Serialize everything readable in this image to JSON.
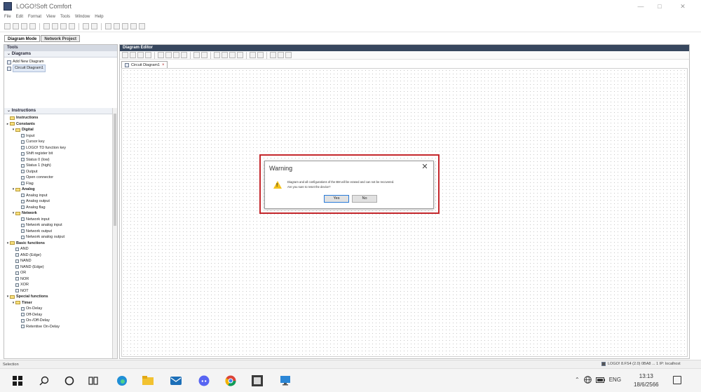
{
  "window": {
    "title": "LOGO!Soft Comfort",
    "controls": [
      "—",
      "□",
      "✕"
    ]
  },
  "menu": [
    "File",
    "Edit",
    "Format",
    "View",
    "Tools",
    "Window",
    "Help"
  ],
  "tabs": [
    "Diagram Mode",
    "Network Project"
  ],
  "left_panel": {
    "header": "Tools",
    "diagrams_title": "Diagrams",
    "diagrams": [
      "Add New Diagram",
      "Circuit Diagram1"
    ],
    "instructions_title": "Instructions",
    "tree": [
      {
        "level": 0,
        "label": "Instructions",
        "type": "folder",
        "expander": "",
        "bold": true
      },
      {
        "level": 0,
        "label": "Constants",
        "type": "folder",
        "expander": "▸",
        "bold": true
      },
      {
        "level": 1,
        "label": "Digital",
        "type": "folder",
        "expander": "▾",
        "bold": true
      },
      {
        "level": 2,
        "label": "Input",
        "type": "leaf"
      },
      {
        "level": 2,
        "label": "Cursor key",
        "type": "leaf"
      },
      {
        "level": 2,
        "label": "LOGO! TD function key",
        "type": "leaf"
      },
      {
        "level": 2,
        "label": "Shift register bit",
        "type": "leaf"
      },
      {
        "level": 2,
        "label": "Status 0 (low)",
        "type": "leaf"
      },
      {
        "level": 2,
        "label": "Status 1 (high)",
        "type": "leaf"
      },
      {
        "level": 2,
        "label": "Output",
        "type": "leaf"
      },
      {
        "level": 2,
        "label": "Open connector",
        "type": "leaf"
      },
      {
        "level": 2,
        "label": "Flag",
        "type": "leaf"
      },
      {
        "level": 1,
        "label": "Analog",
        "type": "folder",
        "expander": "▾",
        "bold": true
      },
      {
        "level": 2,
        "label": "Analog input",
        "type": "leaf"
      },
      {
        "level": 2,
        "label": "Analog output",
        "type": "leaf"
      },
      {
        "level": 2,
        "label": "Analog flag",
        "type": "leaf"
      },
      {
        "level": 1,
        "label": "Network",
        "type": "folder",
        "expander": "▾",
        "bold": true
      },
      {
        "level": 2,
        "label": "Network input",
        "type": "leaf"
      },
      {
        "level": 2,
        "label": "Network analog input",
        "type": "leaf"
      },
      {
        "level": 2,
        "label": "Network output",
        "type": "leaf"
      },
      {
        "level": 2,
        "label": "Network analog output",
        "type": "leaf"
      },
      {
        "level": 0,
        "label": "Basic functions",
        "type": "folder",
        "expander": "▾",
        "bold": true
      },
      {
        "level": 1,
        "label": "AND",
        "type": "leaf"
      },
      {
        "level": 1,
        "label": "AND (Edge)",
        "type": "leaf"
      },
      {
        "level": 1,
        "label": "NAND",
        "type": "leaf"
      },
      {
        "level": 1,
        "label": "NAND (Edge)",
        "type": "leaf"
      },
      {
        "level": 1,
        "label": "OR",
        "type": "leaf"
      },
      {
        "level": 1,
        "label": "NOR",
        "type": "leaf"
      },
      {
        "level": 1,
        "label": "XOR",
        "type": "leaf"
      },
      {
        "level": 1,
        "label": "NOT",
        "type": "leaf"
      },
      {
        "level": 0,
        "label": "Special functions",
        "type": "folder",
        "expander": "▾",
        "bold": true
      },
      {
        "level": 1,
        "label": "Timer",
        "type": "folder",
        "expander": "▾",
        "bold": true
      },
      {
        "level": 2,
        "label": "On-Delay",
        "type": "leaf"
      },
      {
        "level": 2,
        "label": "Off-Delay",
        "type": "leaf"
      },
      {
        "level": 2,
        "label": "On-/Off-Delay",
        "type": "leaf"
      },
      {
        "level": 2,
        "label": "Retentive On-Delay",
        "type": "leaf"
      }
    ]
  },
  "editor": {
    "header": "Diagram Editor",
    "doc_tab": "Circuit Diagram1",
    "doc_tab_close": "×"
  },
  "dialog": {
    "title": "Warning",
    "close": "✕",
    "message_line1": "Diagram and all configurations of the BM will be erased and can not be recovered.",
    "message_line2": "Are you sure to reset the device?",
    "yes_label": "Yes",
    "no_label": "No"
  },
  "status": {
    "left": "Selection",
    "right": "LOGO! 8.FS4 (2.0) 0BA8 ... 1 IP: localhost"
  },
  "taskbar": {
    "lang": "ENG",
    "time": "13:13",
    "date": "18/6/2566"
  }
}
